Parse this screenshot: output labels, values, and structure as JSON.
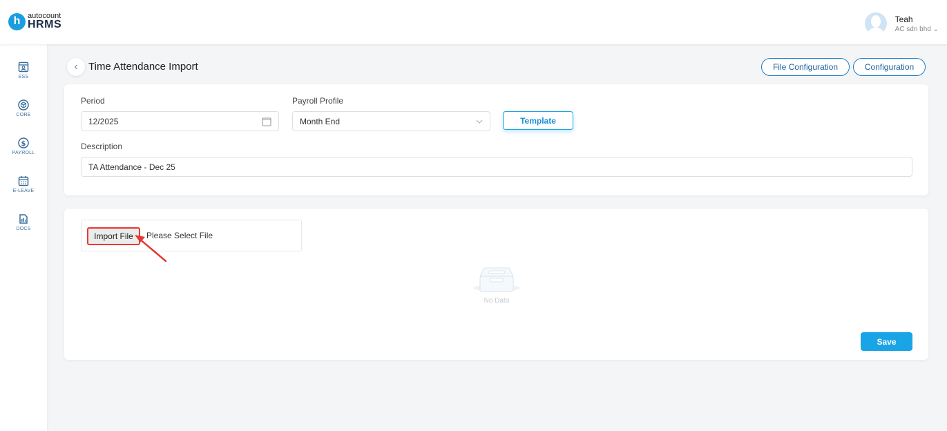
{
  "app": {
    "logo_letter": "h",
    "logo_top": "autocount",
    "logo_main": "HRMS"
  },
  "user": {
    "name": "Teah",
    "company": "AC sdn bhd ⌄"
  },
  "sidebar": {
    "items": [
      {
        "label": "ESS",
        "icon": "ess-icon"
      },
      {
        "label": "CORE",
        "icon": "cube-icon"
      },
      {
        "label": "PAYROLL",
        "icon": "dollar-icon"
      },
      {
        "label": "E-LEAVE",
        "icon": "calendar-icon"
      },
      {
        "label": "DOCS",
        "icon": "document-icon"
      }
    ]
  },
  "page": {
    "title": "Time Attendance Import",
    "back_icon": "‹",
    "file_config_label": "File Configuration",
    "config_label": "Configuration"
  },
  "form": {
    "period_label": "Period",
    "period_value": "12/2025",
    "payroll_profile_label": "Payroll Profile",
    "payroll_profile_value": "Month End",
    "template_label": "Template",
    "description_label": "Description",
    "description_value": "TA Attendance - Dec 25"
  },
  "import": {
    "button_label": "Import File",
    "file_placeholder": "Please Select File",
    "empty_text": "No Data",
    "save_label": "Save"
  },
  "colors": {
    "accent": "#19a4e6",
    "highlight": "#e53935",
    "nav_icon": "#3a6e9a"
  }
}
